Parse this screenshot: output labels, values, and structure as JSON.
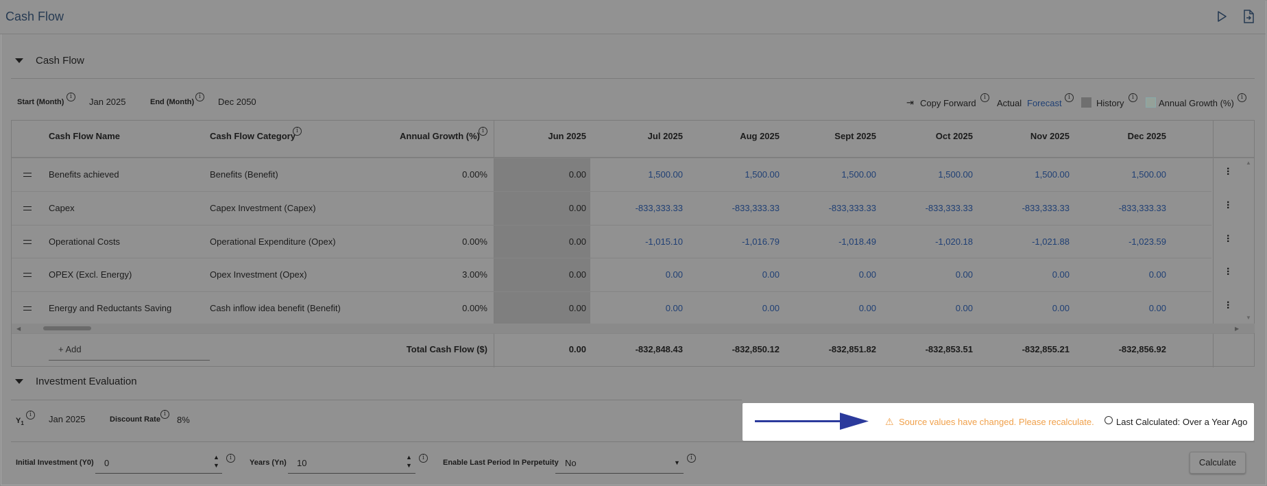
{
  "header": {
    "title": "Cash Flow",
    "play_icon": "play-icon",
    "export_icon": "file-export-icon"
  },
  "cashflow_section": {
    "title": "Cash Flow",
    "start_label": "Start (Month)",
    "start_value": "Jan 2025",
    "end_label": "End (Month)",
    "end_value": "Dec 2050",
    "copy_forward": "Copy Forward",
    "actual": "Actual",
    "forecast": "Forecast",
    "history": "History",
    "annual_growth": "Annual Growth (%)"
  },
  "table": {
    "headers": {
      "name": "Cash Flow Name",
      "category": "Cash Flow Category",
      "growth": "Annual Growth (%)",
      "months": [
        "Jun 2025",
        "Jul 2025",
        "Aug 2025",
        "Sept 2025",
        "Oct 2025",
        "Nov 2025",
        "Dec 2025"
      ]
    },
    "rows": [
      {
        "name": "Benefits achieved",
        "category": "Benefits (Benefit)",
        "growth": "0.00%",
        "values": [
          "0.00",
          "1,500.00",
          "1,500.00",
          "1,500.00",
          "1,500.00",
          "1,500.00",
          "1,500.00"
        ]
      },
      {
        "name": "Capex",
        "category": "Capex Investment (Capex)",
        "growth": "",
        "values": [
          "0.00",
          "-833,333.33",
          "-833,333.33",
          "-833,333.33",
          "-833,333.33",
          "-833,333.33",
          "-833,333.33"
        ]
      },
      {
        "name": "Operational Costs",
        "category": "Operational Expenditure (Opex)",
        "growth": "0.00%",
        "values": [
          "0.00",
          "-1,015.10",
          "-1,016.79",
          "-1,018.49",
          "-1,020.18",
          "-1,021.88",
          "-1,023.59"
        ]
      },
      {
        "name": "OPEX (Excl. Energy)",
        "category": "Opex Investment (Opex)",
        "growth": "3.00%",
        "values": [
          "0.00",
          "0.00",
          "0.00",
          "0.00",
          "0.00",
          "0.00",
          "0.00"
        ]
      },
      {
        "name": "Energy and Reductants Saving",
        "category": "Cash inflow idea benefit (Benefit)",
        "growth": "0.00%",
        "values": [
          "0.00",
          "0.00",
          "0.00",
          "0.00",
          "0.00",
          "0.00",
          "0.00"
        ]
      }
    ],
    "add_label": "+ Add",
    "total_label": "Total Cash Flow ($)",
    "totals": [
      "0.00",
      "-832,848.43",
      "-832,850.12",
      "-832,851.82",
      "-832,853.51",
      "-832,855.21",
      "-832,856.92"
    ]
  },
  "investment_section": {
    "title": "Investment Evaluation",
    "y1_label": "Y",
    "y1_sub": "1",
    "y1_value": "Jan 2025",
    "discount_label": "Discount Rate",
    "discount_value": "8%",
    "warning_text": "Source values have changed. Please recalculate.",
    "last_calculated": "Last Calculated: Over a Year Ago",
    "initial_investment_label": "Initial Investment (Y0)",
    "initial_investment_value": "0",
    "years_label": "Years (Yn)",
    "years_value": "10",
    "perpetuity_label": "Enable Last Period In Perpetuity",
    "perpetuity_value": "No",
    "calculate_label": "Calculate"
  },
  "colors": {
    "accent_blue": "#1f3f74",
    "warning_orange": "#f0a04a",
    "arrow_blue": "#2b3a9c"
  }
}
